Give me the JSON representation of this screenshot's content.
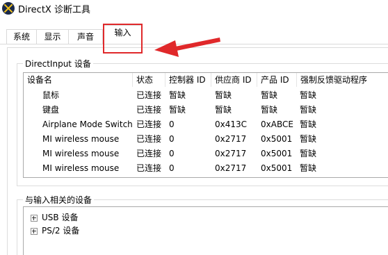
{
  "window": {
    "title": "DirectX 诊断工具",
    "icon": "directx-icon"
  },
  "tabs": [
    {
      "label": "系统"
    },
    {
      "label": "显示"
    },
    {
      "label": "声音"
    },
    {
      "label": "输入",
      "active": true
    }
  ],
  "directinput": {
    "group_title": "DirectInput 设备",
    "columns": [
      "设备名",
      "状态",
      "控制器 ID",
      "供应商 ID",
      "产品 ID",
      "强制反馈驱动程序"
    ],
    "rows": [
      [
        "鼠标",
        "已连接",
        "暂缺",
        "暂缺",
        "暂缺",
        "暂缺"
      ],
      [
        "键盘",
        "已连接",
        "暂缺",
        "暂缺",
        "暂缺",
        "暂缺"
      ],
      [
        "Airplane Mode Switch",
        "已连接",
        "0",
        "0x413C",
        "0xABCE",
        "暂缺"
      ],
      [
        "MI wireless mouse",
        "已连接",
        "0",
        "0x2717",
        "0x5001",
        "暂缺"
      ],
      [
        "MI wireless mouse",
        "已连接",
        "0",
        "0x2717",
        "0x5001",
        "暂缺"
      ],
      [
        "MI wireless mouse",
        "已连接",
        "0",
        "0x2717",
        "0x5001",
        "暂缺"
      ]
    ]
  },
  "related": {
    "group_title": "与输入相关的设备",
    "items": [
      {
        "label": "USB 设备"
      },
      {
        "label": "PS/2 设备"
      }
    ]
  },
  "annotation": {
    "highlight_color": "#e0282a"
  }
}
